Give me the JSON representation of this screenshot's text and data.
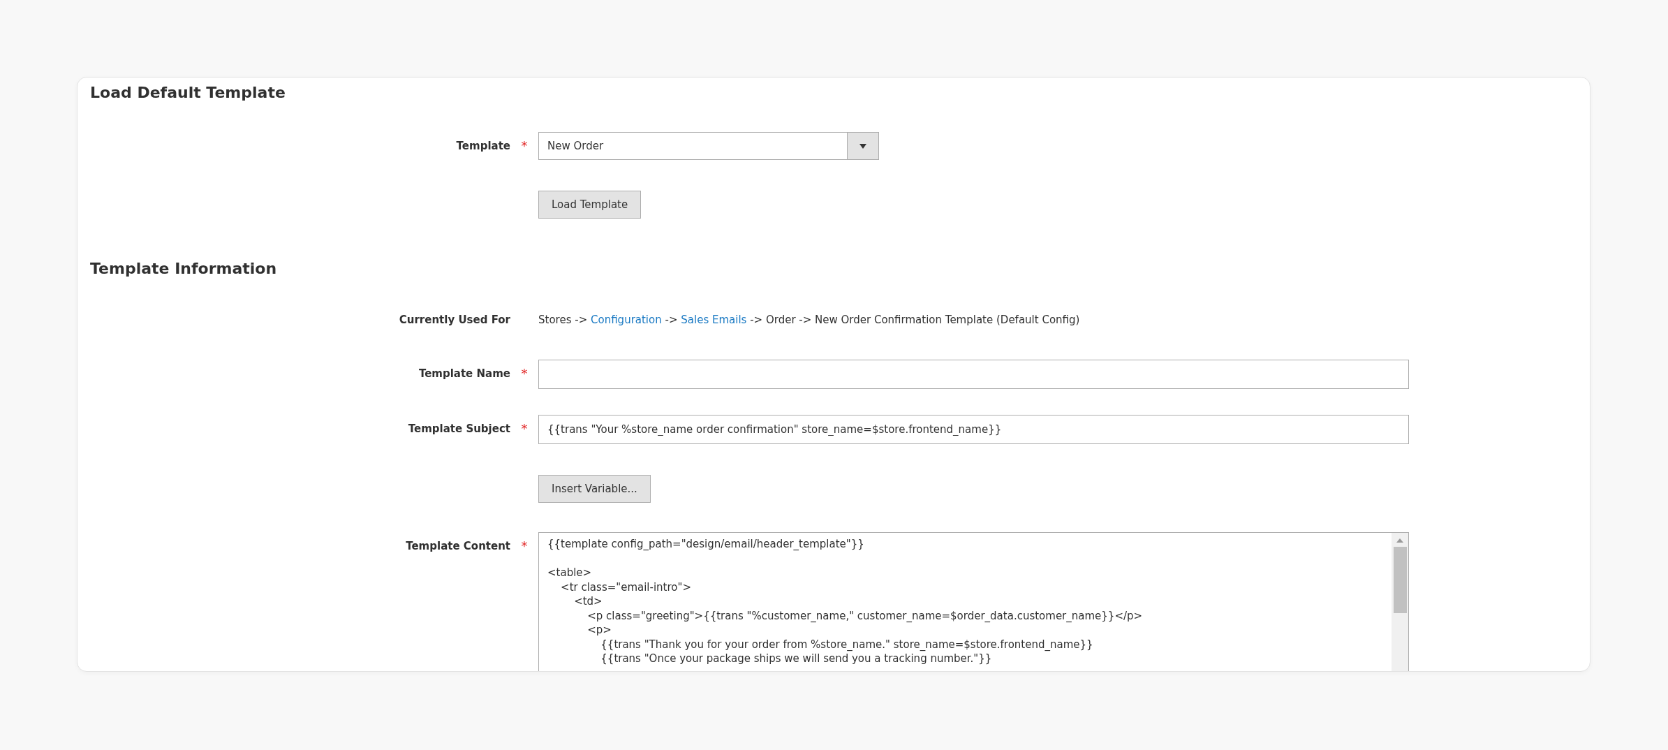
{
  "sections": [
    {
      "title": "Load Default Template",
      "rows": [
        {
          "kind": "select",
          "label": "Template",
          "required_mark": "*",
          "value": "New Order"
        },
        {
          "kind": "button",
          "label": "Load Template"
        }
      ]
    },
    {
      "title": "Template Information",
      "rows": [
        {
          "kind": "breadcrumb",
          "label": "Currently Used For",
          "parts": [
            {
              "kind": "text",
              "text": "Stores ->"
            },
            {
              "kind": "link",
              "text": "Configuration"
            },
            {
              "kind": "text",
              "text": "->"
            },
            {
              "kind": "link",
              "text": "Sales Emails"
            },
            {
              "kind": "text",
              "text": "-> Order -> New Order Confirmation Template  (Default Config)"
            }
          ]
        },
        {
          "kind": "input",
          "label": "Template Name",
          "required_mark": "*"
        },
        {
          "kind": "input",
          "label": "Template Subject",
          "required_mark": "*",
          "value": "{{trans \"Your %store_name order confirmation\" store_name=$store.frontend_name}}"
        },
        {
          "kind": "button",
          "label": "Insert Variable..."
        },
        {
          "kind": "textarea",
          "label": "Template Content",
          "required_mark": "*",
          "lines": [
            "{{template config_path=\"design/email/header_template\"}}\n",
            "<table>",
            "    <tr class=\"email-intro\">",
            "        <td>",
            "            <p class=\"greeting\">{{trans \"%customer_name,\" customer_name=$order_data.customer_name}}</p>",
            "            <p>",
            "                {{trans \"Thank you for your order from %store_name.\" store_name=$store.frontend_name}}",
            "                {{trans \"Once your package ships we will send you a tracking number.\"}}"
          ]
        }
      ]
    }
  ]
}
